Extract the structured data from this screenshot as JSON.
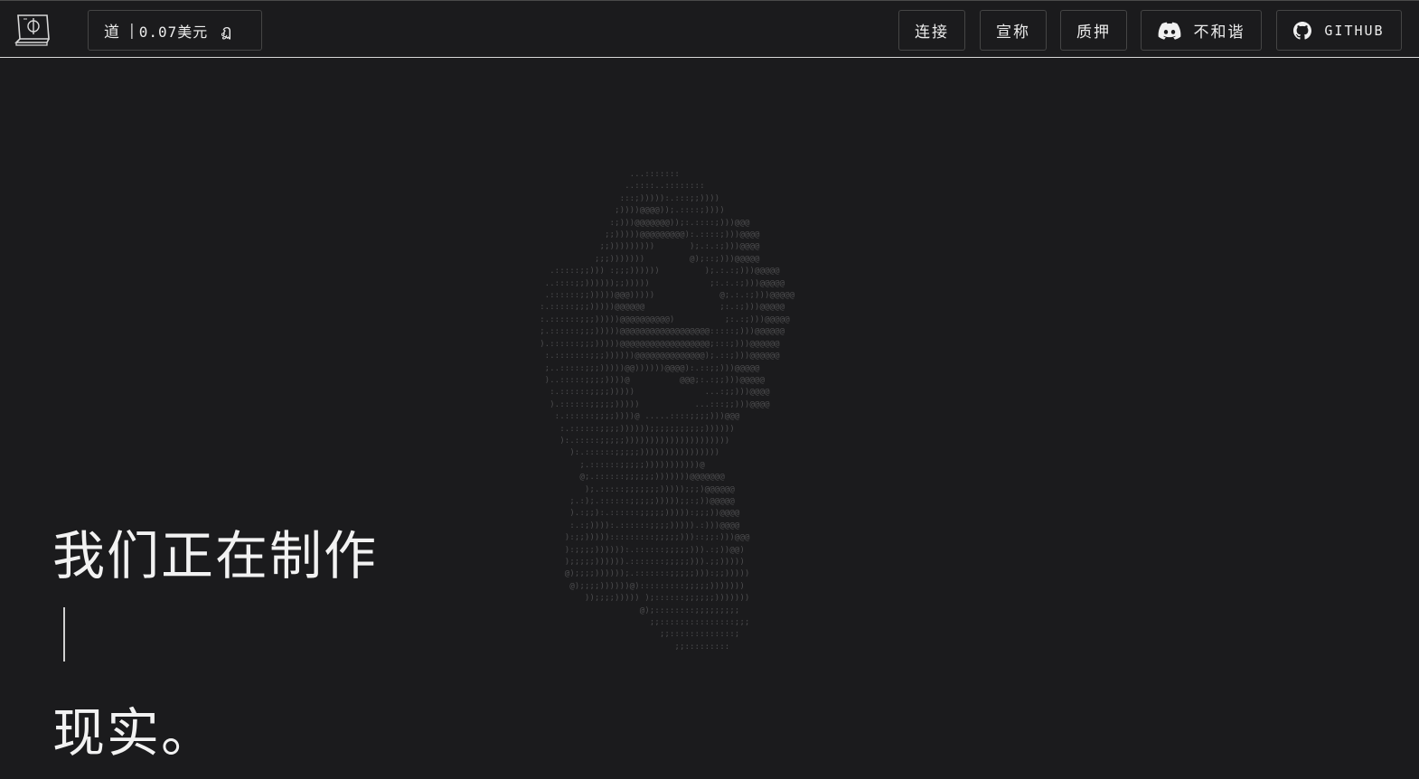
{
  "header": {
    "token_symbol": "道",
    "separator": "|",
    "price": "0.07美元",
    "price_glyph": "ฏ",
    "nav": {
      "connect": "连接",
      "claim": "宣称",
      "stake": "质押",
      "discord": "不和谐",
      "github": "GITHUB"
    },
    "icons": {
      "logo": "book-phi-icon",
      "discord": "discord-icon",
      "github": "github-icon"
    }
  },
  "hero": {
    "line1": "我们正在制作",
    "line2": "现实。"
  },
  "colors": {
    "background": "#1b1b1d",
    "text": "#f2f2f2",
    "border": "#454545",
    "ascii": "#4d4d4f"
  }
}
